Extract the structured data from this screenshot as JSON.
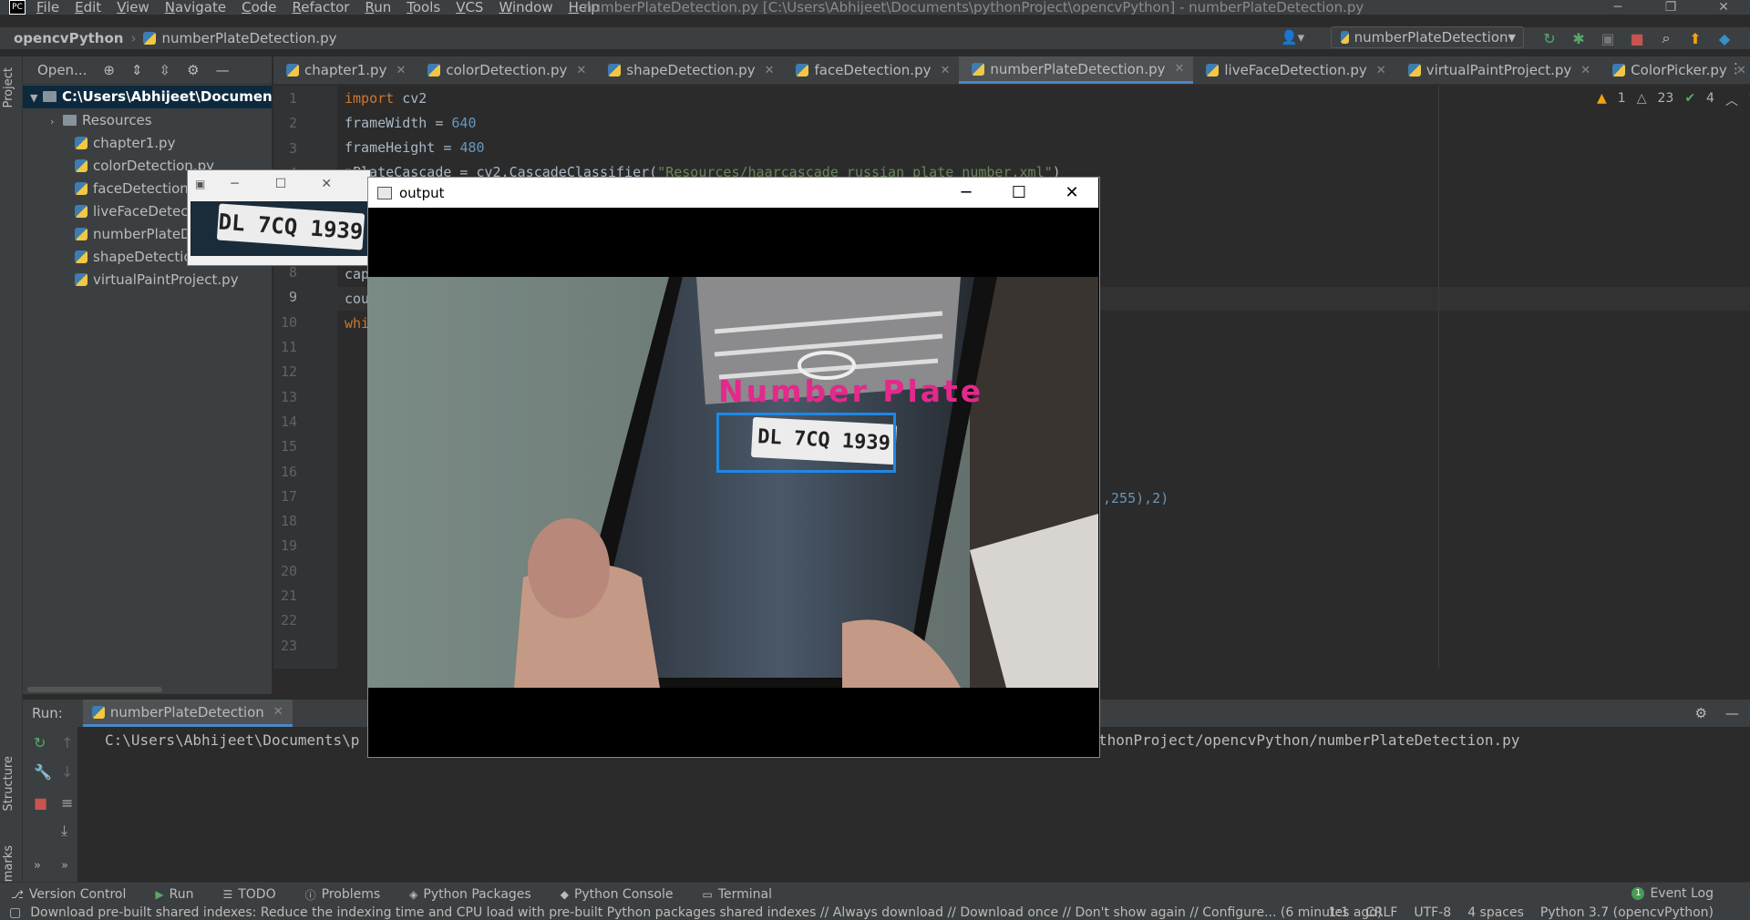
{
  "menu": [
    "File",
    "Edit",
    "View",
    "Navigate",
    "Code",
    "Refactor",
    "Run",
    "Tools",
    "VCS",
    "Window",
    "Help"
  ],
  "window_title": "numberPlateDetection.py [C:\\Users\\Abhijeet\\Documents\\pythonProject\\opencvPython] - numberPlateDetection.py",
  "breadcrumb": {
    "project": "opencvPython",
    "file": "numberPlateDetection.py"
  },
  "run_config": "numberPlateDetection",
  "project_tool": {
    "view_label": "Open..."
  },
  "project_tree": {
    "root": "C:\\Users\\Abhijeet\\Documents\\",
    "items": [
      "Resources",
      "chapter1.py",
      "colorDetection.py",
      "faceDetection.py",
      "liveFaceDetection.py",
      "numberPlateDetection.py",
      "shapeDetection.py",
      "virtualPaintProject.py"
    ]
  },
  "tabs": [
    {
      "label": "chapter1.py"
    },
    {
      "label": "colorDetection.py"
    },
    {
      "label": "shapeDetection.py"
    },
    {
      "label": "faceDetection.py"
    },
    {
      "label": "numberPlateDetection.py",
      "active": true
    },
    {
      "label": "liveFaceDetection.py"
    },
    {
      "label": "virtualPaintProject.py"
    },
    {
      "label": "ColorPicker.py"
    }
  ],
  "inspections": {
    "warn1": "1",
    "warn2": "23",
    "ok": "4"
  },
  "line_numbers": [
    "1",
    "2",
    "3",
    "4",
    "5",
    "6",
    "7",
    "8",
    "9",
    "10",
    "11",
    "12",
    "13",
    "14",
    "15",
    "16",
    "17",
    "18",
    "19",
    "20",
    "21",
    "22",
    "23"
  ],
  "code": {
    "l1_kw": "import",
    "l1_rest": " cv2",
    "l2_a": "frameWidth = ",
    "l2_num": "640",
    "l3_a": "frameHeight = ",
    "l3_num": "480",
    "l4_a": "nPlateCascade = cv2.CascadeClassifier(",
    "l4_str": "\"Resources/haarcascade_russian_plate_number.xml\"",
    "l4_b": ")",
    "l8": "cap",
    "l9": "cou",
    "l10": "whi",
    "l17_tail": ",255),2)"
  },
  "run": {
    "label": "Run:",
    "tab": "numberPlateDetection",
    "output_left": "C:\\Users\\Abhijeet\\Documents\\p",
    "output_right": "thonProject/opencvPython/numberPlateDetection.py"
  },
  "side_labels": {
    "project": "Project",
    "structure": "Structure",
    "bookmarks": "Bookmarks"
  },
  "bottom_tools": [
    "Version Control",
    "Run",
    "TODO",
    "Problems",
    "Python Packages",
    "Python Console",
    "Terminal"
  ],
  "event_log": {
    "count": "1",
    "label": "Event Log"
  },
  "status": {
    "message": "Download pre-built shared indexes: Reduce the indexing time and CPU load with pre-built Python packages shared indexes // Always download // Download once // Don't show again // Configure... (6 minutes ago)",
    "position": "1:1",
    "line_sep": "CRLF",
    "encoding": "UTF-8",
    "indent": "4 spaces",
    "interpreter": "Python 3.7 (opencvPython)"
  },
  "output_window": {
    "title": "output",
    "label": "Number Plate",
    "plate": "DL 7CQ 1939"
  },
  "small_window": {
    "plate": "DL 7CQ 1939"
  },
  "colors": {
    "accent": "#4a88c7",
    "label_magenta": "#e4288c",
    "box_blue": "#1e88e5"
  }
}
